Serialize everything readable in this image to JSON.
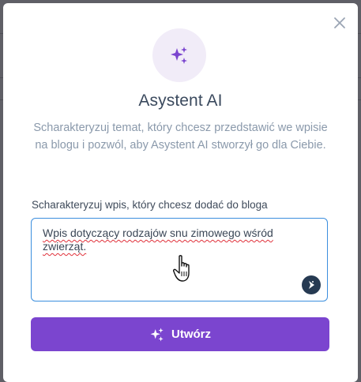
{
  "modal": {
    "title": "Asystent AI",
    "description": "Scharakteryzuj temat, który chcesz przedstawić we wpisie na blogu i pozwól, aby Asystent AI stworzył go dla Ciebie.",
    "field_label": "Scharakteryzuj wpis, który chcesz dodać do bloga",
    "field_value": "Wpis dotyczący rodzajów snu zimowego wśród zwierząt.",
    "submit_label": "Utwórz"
  },
  "icons": {
    "header": "sparkles-icon",
    "close": "close-icon",
    "assistant_badge": "assistant-badge-icon",
    "submit": "sparkles-icon",
    "cursor": "hand-pointer-cursor"
  },
  "colors": {
    "accent": "#7b45cf",
    "title": "#3b4a5e",
    "muted": "#8a99ab",
    "focus_border": "#3b8ede",
    "spell_underline": "#e0303a"
  }
}
